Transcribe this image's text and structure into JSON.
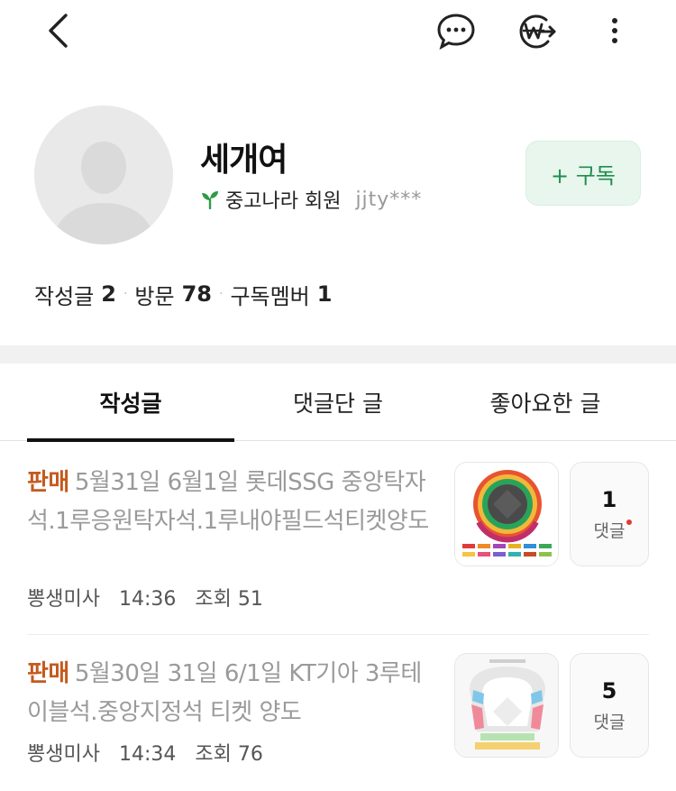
{
  "header": {
    "back_icon": "chevron-left-icon",
    "chat_icon": "chat-bubble-icon",
    "won_icon": "won-transfer-icon",
    "more_icon": "vertical-dots-icon"
  },
  "profile": {
    "nickname": "세개여",
    "member_label": "중고나라 회원",
    "user_id": "jjty***",
    "subscribe_label": "+ 구독",
    "accent_color": "#1f8f4e"
  },
  "stats": [
    {
      "label": "작성글",
      "value": "2"
    },
    {
      "label": "방문",
      "value": "78"
    },
    {
      "label": "구독멤버",
      "value": "1"
    }
  ],
  "tabs": [
    {
      "label": "작성글",
      "active": true
    },
    {
      "label": "댓글단 글",
      "active": false
    },
    {
      "label": "좋아요한 글",
      "active": false
    }
  ],
  "posts": [
    {
      "tag": "판매",
      "title": "5월31일 6월1일 롯데SSG 중앙탁자석.1루응원탁자석.1루내야필드석티켓양도",
      "author": "뽕생미사",
      "time": "14:36",
      "views_label": "조회",
      "views": "51",
      "comment_count": "1",
      "comment_label": "댓글",
      "has_new_comment": true
    },
    {
      "tag": "판매",
      "title": "5월30일 31일 6/1일 KT기아 3루테이블석.중앙지정석 티켓 양도",
      "author": "뽕생미사",
      "time": "14:34",
      "views_label": "조회",
      "views": "76",
      "comment_count": "5",
      "comment_label": "댓글",
      "has_new_comment": false
    }
  ]
}
